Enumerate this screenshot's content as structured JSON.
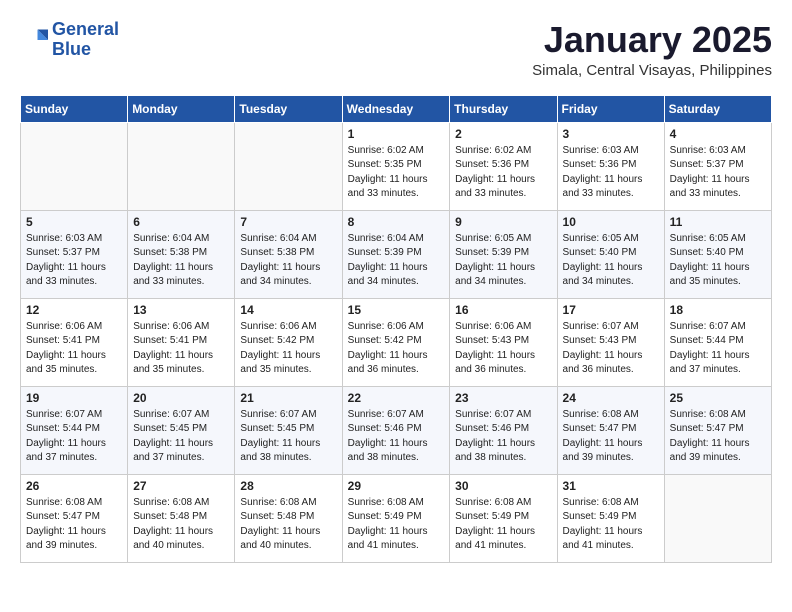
{
  "header": {
    "logo_line1": "General",
    "logo_line2": "Blue",
    "month": "January 2025",
    "location": "Simala, Central Visayas, Philippines"
  },
  "weekdays": [
    "Sunday",
    "Monday",
    "Tuesday",
    "Wednesday",
    "Thursday",
    "Friday",
    "Saturday"
  ],
  "weeks": [
    [
      {
        "day": "",
        "info": ""
      },
      {
        "day": "",
        "info": ""
      },
      {
        "day": "",
        "info": ""
      },
      {
        "day": "1",
        "info": "Sunrise: 6:02 AM\nSunset: 5:35 PM\nDaylight: 11 hours\nand 33 minutes."
      },
      {
        "day": "2",
        "info": "Sunrise: 6:02 AM\nSunset: 5:36 PM\nDaylight: 11 hours\nand 33 minutes."
      },
      {
        "day": "3",
        "info": "Sunrise: 6:03 AM\nSunset: 5:36 PM\nDaylight: 11 hours\nand 33 minutes."
      },
      {
        "day": "4",
        "info": "Sunrise: 6:03 AM\nSunset: 5:37 PM\nDaylight: 11 hours\nand 33 minutes."
      }
    ],
    [
      {
        "day": "5",
        "info": "Sunrise: 6:03 AM\nSunset: 5:37 PM\nDaylight: 11 hours\nand 33 minutes."
      },
      {
        "day": "6",
        "info": "Sunrise: 6:04 AM\nSunset: 5:38 PM\nDaylight: 11 hours\nand 33 minutes."
      },
      {
        "day": "7",
        "info": "Sunrise: 6:04 AM\nSunset: 5:38 PM\nDaylight: 11 hours\nand 34 minutes."
      },
      {
        "day": "8",
        "info": "Sunrise: 6:04 AM\nSunset: 5:39 PM\nDaylight: 11 hours\nand 34 minutes."
      },
      {
        "day": "9",
        "info": "Sunrise: 6:05 AM\nSunset: 5:39 PM\nDaylight: 11 hours\nand 34 minutes."
      },
      {
        "day": "10",
        "info": "Sunrise: 6:05 AM\nSunset: 5:40 PM\nDaylight: 11 hours\nand 34 minutes."
      },
      {
        "day": "11",
        "info": "Sunrise: 6:05 AM\nSunset: 5:40 PM\nDaylight: 11 hours\nand 35 minutes."
      }
    ],
    [
      {
        "day": "12",
        "info": "Sunrise: 6:06 AM\nSunset: 5:41 PM\nDaylight: 11 hours\nand 35 minutes."
      },
      {
        "day": "13",
        "info": "Sunrise: 6:06 AM\nSunset: 5:41 PM\nDaylight: 11 hours\nand 35 minutes."
      },
      {
        "day": "14",
        "info": "Sunrise: 6:06 AM\nSunset: 5:42 PM\nDaylight: 11 hours\nand 35 minutes."
      },
      {
        "day": "15",
        "info": "Sunrise: 6:06 AM\nSunset: 5:42 PM\nDaylight: 11 hours\nand 36 minutes."
      },
      {
        "day": "16",
        "info": "Sunrise: 6:06 AM\nSunset: 5:43 PM\nDaylight: 11 hours\nand 36 minutes."
      },
      {
        "day": "17",
        "info": "Sunrise: 6:07 AM\nSunset: 5:43 PM\nDaylight: 11 hours\nand 36 minutes."
      },
      {
        "day": "18",
        "info": "Sunrise: 6:07 AM\nSunset: 5:44 PM\nDaylight: 11 hours\nand 37 minutes."
      }
    ],
    [
      {
        "day": "19",
        "info": "Sunrise: 6:07 AM\nSunset: 5:44 PM\nDaylight: 11 hours\nand 37 minutes."
      },
      {
        "day": "20",
        "info": "Sunrise: 6:07 AM\nSunset: 5:45 PM\nDaylight: 11 hours\nand 37 minutes."
      },
      {
        "day": "21",
        "info": "Sunrise: 6:07 AM\nSunset: 5:45 PM\nDaylight: 11 hours\nand 38 minutes."
      },
      {
        "day": "22",
        "info": "Sunrise: 6:07 AM\nSunset: 5:46 PM\nDaylight: 11 hours\nand 38 minutes."
      },
      {
        "day": "23",
        "info": "Sunrise: 6:07 AM\nSunset: 5:46 PM\nDaylight: 11 hours\nand 38 minutes."
      },
      {
        "day": "24",
        "info": "Sunrise: 6:08 AM\nSunset: 5:47 PM\nDaylight: 11 hours\nand 39 minutes."
      },
      {
        "day": "25",
        "info": "Sunrise: 6:08 AM\nSunset: 5:47 PM\nDaylight: 11 hours\nand 39 minutes."
      }
    ],
    [
      {
        "day": "26",
        "info": "Sunrise: 6:08 AM\nSunset: 5:47 PM\nDaylight: 11 hours\nand 39 minutes."
      },
      {
        "day": "27",
        "info": "Sunrise: 6:08 AM\nSunset: 5:48 PM\nDaylight: 11 hours\nand 40 minutes."
      },
      {
        "day": "28",
        "info": "Sunrise: 6:08 AM\nSunset: 5:48 PM\nDaylight: 11 hours\nand 40 minutes."
      },
      {
        "day": "29",
        "info": "Sunrise: 6:08 AM\nSunset: 5:49 PM\nDaylight: 11 hours\nand 41 minutes."
      },
      {
        "day": "30",
        "info": "Sunrise: 6:08 AM\nSunset: 5:49 PM\nDaylight: 11 hours\nand 41 minutes."
      },
      {
        "day": "31",
        "info": "Sunrise: 6:08 AM\nSunset: 5:49 PM\nDaylight: 11 hours\nand 41 minutes."
      },
      {
        "day": "",
        "info": ""
      }
    ]
  ]
}
